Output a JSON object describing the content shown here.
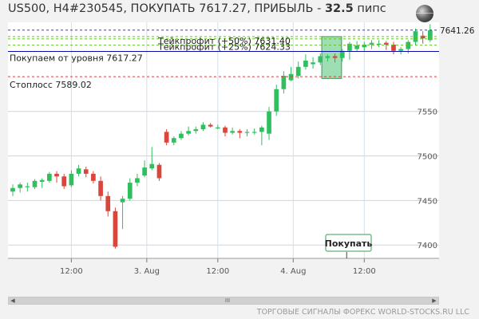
{
  "header": {
    "title_prefix": "US500, H4#230545, ПОКУПАТЬ 7617.27, ПРИБЫЛЬ - ",
    "profit_value": "32.5",
    "profit_unit": " пипс"
  },
  "watermark": "ТОРГОВЫЕ СИГНАЛЫ ФОРЕКС WORLD-STOCKS.RU LLC",
  "scrollbar": {
    "left_arrow": "◀",
    "thumb": "III",
    "right_arrow": "▶"
  },
  "colors": {
    "bull": "#2fbf5f",
    "bear": "#d9473c",
    "entry": "#0a0aa8",
    "stop": "#d04040",
    "take": "#6abf30",
    "zone": "#7dd39a"
  },
  "chart_data": {
    "type": "candlestick",
    "title": "",
    "ylim": [
      7385,
      7650
    ],
    "y_ticks": [
      7400,
      7450,
      7500,
      7550
    ],
    "x_ticks": [
      {
        "index": 8,
        "label": "12:00"
      },
      {
        "index": 18.3,
        "label": "3. Aug"
      },
      {
        "index": 28,
        "label": "12:00"
      },
      {
        "index": 38.3,
        "label": "4. Aug"
      },
      {
        "index": 48,
        "label": "12:00"
      }
    ],
    "grid": true,
    "candles": [
      [
        7460,
        7464,
        7455,
        7468
      ],
      [
        7464,
        7468,
        7459,
        7470
      ],
      [
        7465,
        7466,
        7460,
        7470
      ],
      [
        7465,
        7472,
        7463,
        7474
      ],
      [
        7471,
        7473,
        7464,
        7475
      ],
      [
        7472,
        7480,
        7470,
        7482
      ],
      [
        7480,
        7477,
        7470,
        7483
      ],
      [
        7477,
        7466,
        7463,
        7480
      ],
      [
        7467,
        7480,
        7465,
        7484
      ],
      [
        7480,
        7486,
        7477,
        7490
      ],
      [
        7485,
        7480,
        7476,
        7488
      ],
      [
        7480,
        7472,
        7469,
        7483
      ],
      [
        7472,
        7455,
        7450,
        7477
      ],
      [
        7455,
        7438,
        7432,
        7460
      ],
      [
        7438,
        7398,
        7396,
        7442
      ],
      [
        7448,
        7452,
        7418,
        7455
      ],
      [
        7452,
        7470,
        7450,
        7475
      ],
      [
        7470,
        7475,
        7466,
        7480
      ],
      [
        7478,
        7487,
        7476,
        7495
      ],
      [
        7486,
        7491,
        7484,
        7510
      ],
      [
        7490,
        7475,
        7472,
        7492
      ],
      [
        7527,
        7515,
        7512,
        7530
      ],
      [
        7515,
        7520,
        7512,
        7522
      ],
      [
        7520,
        7525,
        7518,
        7528
      ],
      [
        7525,
        7528,
        7523,
        7533
      ],
      [
        7528,
        7530,
        7525,
        7533
      ],
      [
        7530,
        7535,
        7528,
        7538
      ],
      [
        7535,
        7533,
        7532,
        7537
      ],
      [
        7532,
        7532,
        7530,
        7535
      ],
      [
        7532,
        7526,
        7522,
        7534
      ],
      [
        7526,
        7528,
        7524,
        7532
      ],
      [
        7528,
        7526,
        7520,
        7530
      ],
      [
        7526,
        7527,
        7522,
        7530
      ],
      [
        7527,
        7527,
        7524,
        7531
      ],
      [
        7527,
        7532,
        7512,
        7534
      ],
      [
        7525,
        7550,
        7518,
        7555
      ],
      [
        7550,
        7575,
        7545,
        7580
      ],
      [
        7575,
        7590,
        7570,
        7595
      ],
      [
        7585,
        7592,
        7584,
        7600
      ],
      [
        7590,
        7600,
        7587,
        7606
      ],
      [
        7600,
        7607,
        7597,
        7614
      ],
      [
        7603,
        7605,
        7598,
        7611
      ],
      [
        7605,
        7612,
        7602,
        7615
      ],
      [
        7610,
        7612,
        7606,
        7614
      ],
      [
        7612,
        7610,
        7605,
        7615
      ],
      [
        7610,
        7618,
        7606,
        7620
      ],
      [
        7618,
        7626,
        7608,
        7628
      ],
      [
        7620,
        7624,
        7617,
        7629
      ],
      [
        7622,
        7625,
        7618,
        7628
      ],
      [
        7625,
        7627,
        7620,
        7630
      ],
      [
        7625,
        7626,
        7622,
        7630
      ],
      [
        7627,
        7625,
        7619,
        7629
      ],
      [
        7625,
        7618,
        7614,
        7628
      ],
      [
        7618,
        7620,
        7614,
        7622
      ],
      [
        7620,
        7628,
        7615,
        7630
      ],
      [
        7628,
        7640,
        7624,
        7643
      ],
      [
        7635,
        7632,
        7626,
        7640
      ],
      [
        7630,
        7641,
        7628,
        7648
      ]
    ],
    "levels": [
      {
        "kind": "take-profit-50",
        "value": 7631.4,
        "label": "Тейкпрофит (+50%) 7631.40"
      },
      {
        "kind": "take-profit-25",
        "value": 7624.33,
        "label": "Тейкпрофит (+25%) 7624.33"
      },
      {
        "kind": "entry",
        "value": 7617.27,
        "label": "Покупаем от уровня 7617.27"
      },
      {
        "kind": "stop-loss",
        "value": 7589.02,
        "label": "Стоплосс 7589.02"
      }
    ],
    "current_price": {
      "value": 7641.26,
      "label": "7641.26"
    },
    "signal": {
      "label": "Покупать",
      "direction": "buy"
    }
  }
}
